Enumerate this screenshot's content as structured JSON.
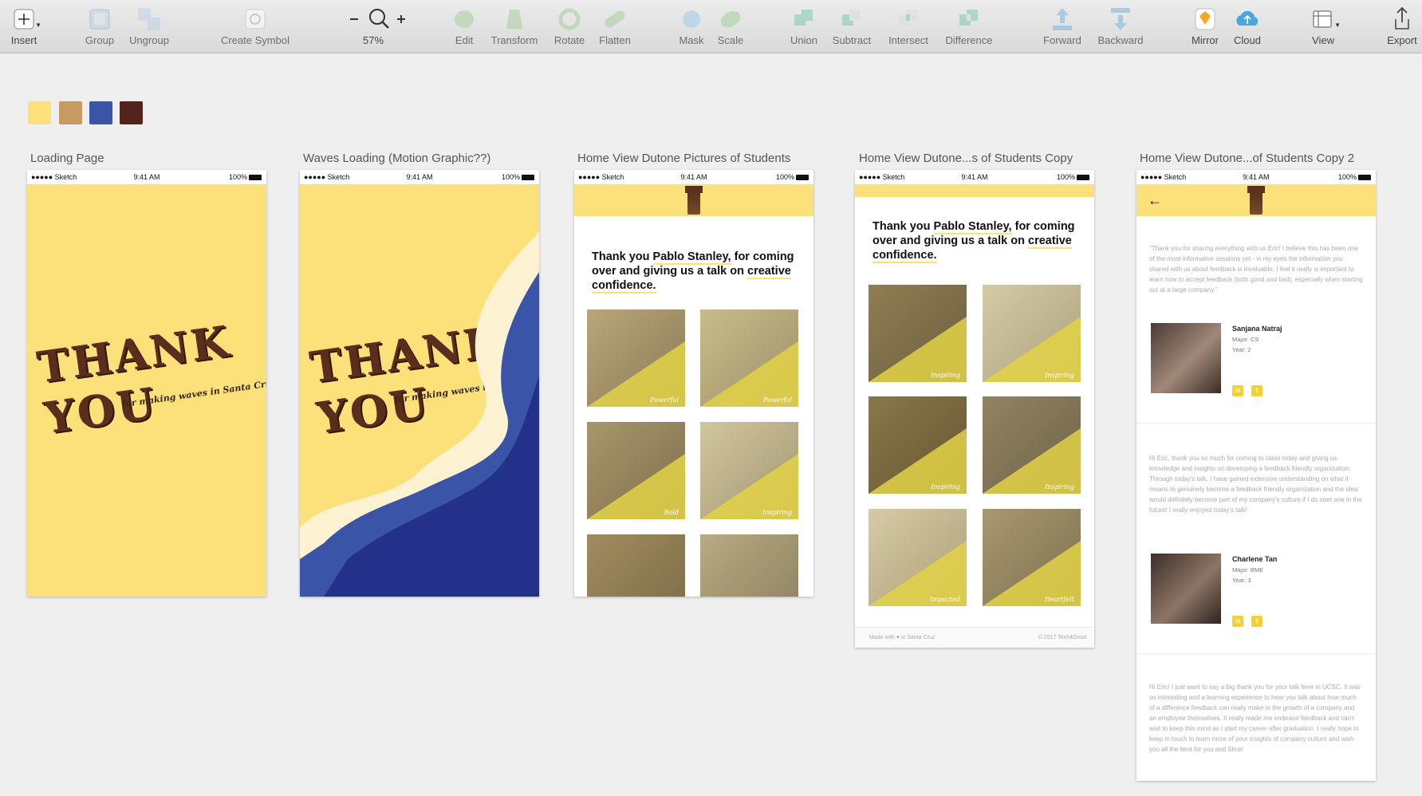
{
  "toolbar": {
    "insert": "Insert",
    "group": "Group",
    "ungroup": "Ungroup",
    "create_symbol": "Create Symbol",
    "zoom": "57%",
    "edit": "Edit",
    "transform": "Transform",
    "rotate": "Rotate",
    "flatten": "Flatten",
    "mask": "Mask",
    "scale": "Scale",
    "union": "Union",
    "subtract": "Subtract",
    "intersect": "Intersect",
    "difference": "Difference",
    "forward": "Forward",
    "backward": "Backward",
    "mirror": "Mirror",
    "cloud": "Cloud",
    "view": "View",
    "export": "Export"
  },
  "swatches": [
    "#fce07a",
    "#c89a62",
    "#3a55a7",
    "#54231c"
  ],
  "status_bar": {
    "carrier": "●●●●● Sketch",
    "time": "9:41 AM",
    "battery": "100%"
  },
  "artboards": {
    "loading": {
      "title": "Loading Page"
    },
    "waves": {
      "title": "Waves Loading (Motion Graphic??)"
    },
    "home1": {
      "title": "Home View Dutone Pictures of Students"
    },
    "home2": {
      "title": "Home View Dutone...s of Students Copy"
    },
    "home3": {
      "title": "Home View Dutone...of Students Copy 2"
    }
  },
  "splash": {
    "headline": "THANK YOU",
    "tagline": "for making waves in Santa Cruz",
    "tagline_short": "for making waves i"
  },
  "thanks": {
    "prefix": "Thank you ",
    "name": "Pablo Stanley,",
    "rest": " for coming over and giving us a talk on ",
    "emph": "creative confidence."
  },
  "home1_captions": [
    "Powerful",
    "Powerful",
    "Bold",
    "Inspiring"
  ],
  "home2_captions": [
    "Inspiring",
    "Inspiring",
    "Inspiring",
    "Inspiring",
    "Impacted",
    "Heartfelt"
  ],
  "footer": {
    "left": "Made with ♥ in Santa Cruz",
    "right": "© 2017 Tech4Good"
  },
  "testimonials": [
    {
      "quote": "\"Thank you for sharing everything with us Eric! I believe this has been one of the most informative sessions yet - in my eyes the information you shared with us about feedback is invaluable; I feel it really is important to learn how to accept feedback (both good and bad), especially when starting out at a large company.\"",
      "name": "Sanjana Natraj",
      "major": "Major: CS",
      "year": "Year: 2"
    },
    {
      "quote": "Hi Eric, thank you so much for coming to class today and giving us knowledge and insights on developing a feedback friendly organization. Through today's talk, I have gained extensive understanding on what it means to genuinely become a feedback friendly organization and the idea would definitely become part of my company's culture if I do start one in the future! I really enjoyed today's talk!",
      "name": "Charlene Tan",
      "major": "Major: BME",
      "year": "Year: 3"
    },
    {
      "quote": "Hi Eric! I just want to say a big thank you for your talk here in UCSC. It was so interesting and a learning experience to hear you talk about how much of a difference feedback can really make in the growth of a company and an employee themselves. It really made me embrace feedback and can't wait to keep this mind as I start my career after graduation. I really hope to keep in touch to learn more of your insights of company culture and wish you all the best for you and Slice!"
    }
  ]
}
